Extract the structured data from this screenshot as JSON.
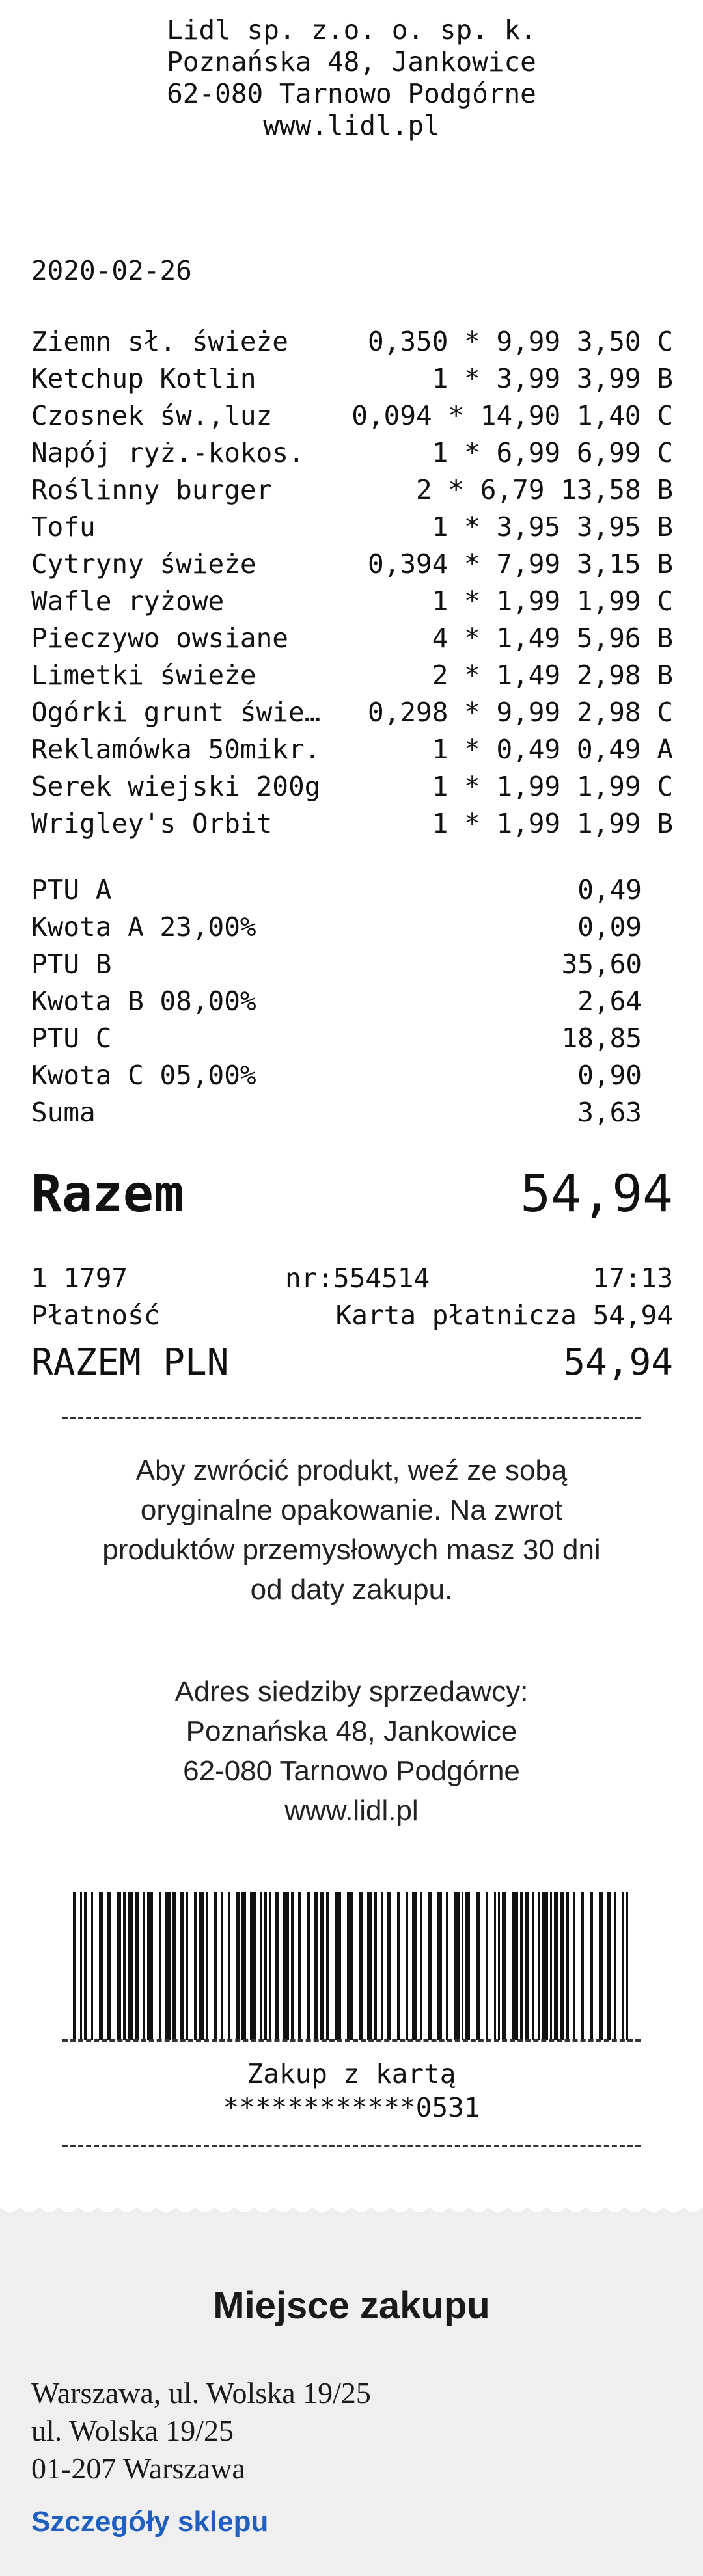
{
  "header": {
    "company": "Lidl sp. z.o. o. sp. k.",
    "street": "Poznańska 48, Jankowice",
    "city": "62-080 Tarnowo Podgórne",
    "web": "www.lidl.pl"
  },
  "date": "2020-02-26",
  "items": [
    {
      "name": "Ziemn sł. świeże",
      "qty": "0,350",
      "price": "9,99",
      "total": "3,50",
      "tax": "C"
    },
    {
      "name": "Ketchup Kotlin",
      "qty": "1",
      "price": "3,99",
      "total": "3,99",
      "tax": "B"
    },
    {
      "name": "Czosnek św.,luz",
      "qty": "0,094",
      "price": "14,90",
      "total": "1,40",
      "tax": "C"
    },
    {
      "name": "Napój ryż.-kokos.",
      "qty": "1",
      "price": "6,99",
      "total": "6,99",
      "tax": "C"
    },
    {
      "name": "Roślinny burger",
      "qty": "2",
      "price": "6,79",
      "total": "13,58",
      "tax": "B"
    },
    {
      "name": "Tofu",
      "qty": "1",
      "price": "3,95",
      "total": "3,95",
      "tax": "B"
    },
    {
      "name": "Cytryny świeże",
      "qty": "0,394",
      "price": "7,99",
      "total": "3,15",
      "tax": "B"
    },
    {
      "name": "Wafle ryżowe",
      "qty": "1",
      "price": "1,99",
      "total": "1,99",
      "tax": "C"
    },
    {
      "name": "Pieczywo owsiane",
      "qty": "4",
      "price": "1,49",
      "total": "5,96",
      "tax": "B"
    },
    {
      "name": "Limetki świeże",
      "qty": "2",
      "price": "1,49",
      "total": "2,98",
      "tax": "B"
    },
    {
      "name": "Ogórki grunt świe…",
      "qty": "0,298",
      "price": "9,99",
      "total": "2,98",
      "tax": "C"
    },
    {
      "name": "Reklamówka 50mikr.",
      "qty": "1",
      "price": "0,49",
      "total": "0,49",
      "tax": "A"
    },
    {
      "name": "Serek wiejski 200g",
      "qty": "1",
      "price": "1,99",
      "total": "1,99",
      "tax": "C"
    },
    {
      "name": "Wrigley's Orbit",
      "qty": "1",
      "price": "1,99",
      "total": "1,99",
      "tax": "B"
    }
  ],
  "tax_rows": [
    {
      "label": "PTU A",
      "value": "0,49"
    },
    {
      "label": "Kwota A 23,00%",
      "value": "0,09"
    },
    {
      "label": "PTU B",
      "value": "35,60"
    },
    {
      "label": "Kwota B 08,00%",
      "value": "2,64"
    },
    {
      "label": "PTU C",
      "value": "18,85"
    },
    {
      "label": "Kwota C 05,00%",
      "value": "0,90"
    },
    {
      "label": "Suma",
      "value": "3,63"
    }
  ],
  "total": {
    "label": "Razem",
    "value": "54,94"
  },
  "transaction": {
    "register": "1 1797",
    "number": "nr:554514",
    "time": "17:13"
  },
  "payment": {
    "label": "Płatność",
    "method": "Karta płatnicza 54,94"
  },
  "total_pln": {
    "label": "RAZEM PLN",
    "value": "54,94"
  },
  "return_notice": [
    "Aby zwrócić produkt, weź ze sobą",
    "oryginalne opakowanie. Na zwrot",
    "produktów przemysłowych masz 30 dni",
    "od daty zakupu."
  ],
  "seller_address": [
    "Adres siedziby sprzedawcy:",
    "Poznańska 48, Jankowice",
    "62-080 Tarnowo Podgórne",
    "www.lidl.pl"
  ],
  "card": {
    "label": "Zakup z kartą",
    "number": "************0531"
  },
  "store": {
    "title": "Miejsce zakupu",
    "lines": [
      "Warszawa, ul. Wolska 19/25",
      "ul. Wolska 19/25",
      "01-207 Warszawa"
    ],
    "details_link": "Szczegóły sklepu"
  },
  "colors": {
    "link": "#1f5fbf",
    "background": "#efefef",
    "receipt": "#ffffff"
  }
}
